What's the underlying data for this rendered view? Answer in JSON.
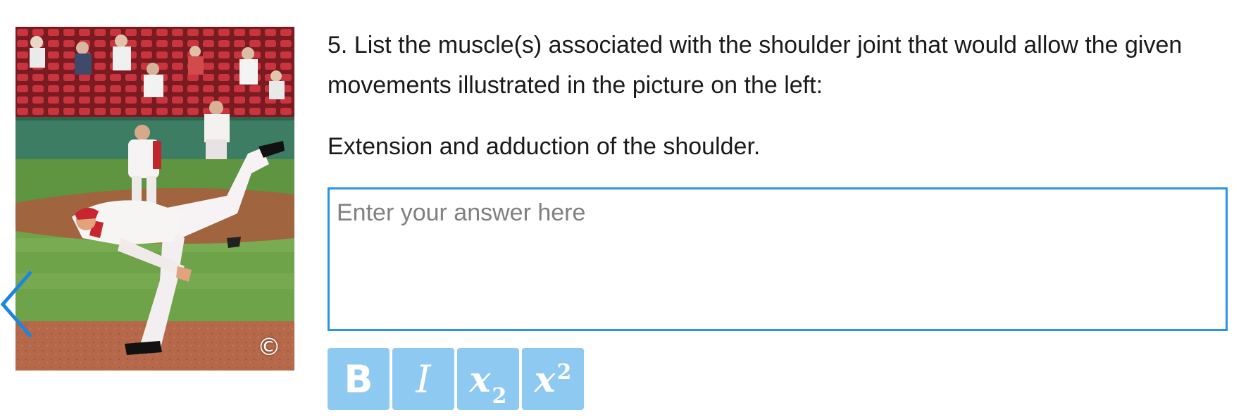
{
  "question": {
    "text": "5. List the muscle(s) associated with the shoulder joint that would allow the given movements illustrated in the picture on the left:",
    "prompt": "Extension and adduction of the shoulder."
  },
  "image": {
    "copyright_symbol": "©",
    "prev_icon": "chevron-left-icon"
  },
  "answer": {
    "value": "",
    "placeholder": "Enter your answer here"
  },
  "toolbar": {
    "bold_label": "B",
    "italic_label": "I",
    "subscript_base": "x",
    "subscript_index": "2",
    "superscript_base": "x",
    "superscript_index": "2"
  },
  "colors": {
    "accent": "#2b93e8",
    "toolbar_button": "#8ec9f1",
    "placeholder": "#808080"
  }
}
